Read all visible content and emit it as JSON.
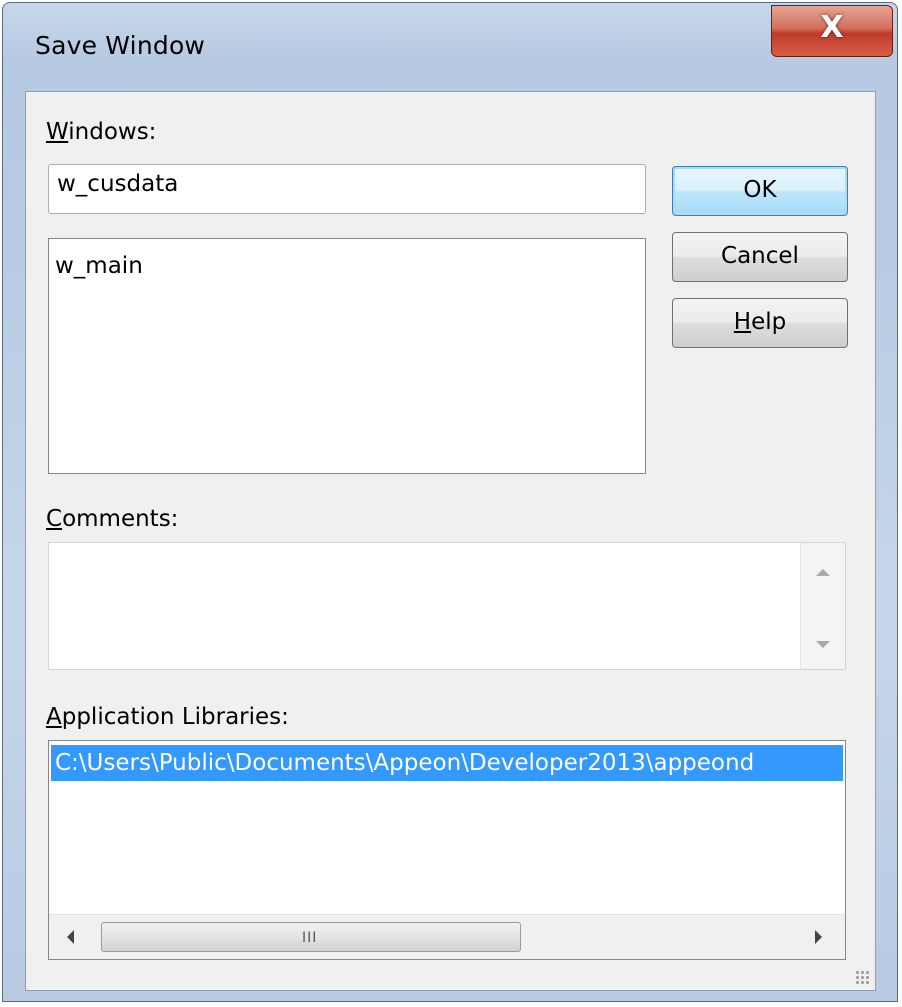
{
  "window": {
    "title": "Save Window",
    "close_glyph": "X"
  },
  "windows_section": {
    "label_accel": "W",
    "label_rest": "indows:",
    "name_value": "w_cusdata",
    "list_items": [
      "w_main"
    ]
  },
  "buttons": {
    "ok": "OK",
    "cancel": "Cancel",
    "help_accel": "H",
    "help_rest": "elp"
  },
  "comments_section": {
    "label_accel": "C",
    "label_rest": "omments:",
    "value": ""
  },
  "libraries_section": {
    "label_accel": "A",
    "label_rest": "pplication Libraries:",
    "items": [
      "C:\\Users\\Public\\Documents\\Appeon\\Developer2013\\appeond"
    ]
  },
  "scrollbar": {
    "thumb_grip": "III"
  },
  "icons": {
    "close": "close-icon",
    "scroll_up": "scroll-up-arrow-icon",
    "scroll_down": "scroll-down-arrow-icon",
    "scroll_left": "scroll-left-arrow-icon",
    "scroll_right": "scroll-right-arrow-icon",
    "resize": "resize-grip-icon"
  },
  "colors": {
    "selection": "#3399ff",
    "default_button_border": "#3c7fb1",
    "close_button": "#c0392b"
  }
}
